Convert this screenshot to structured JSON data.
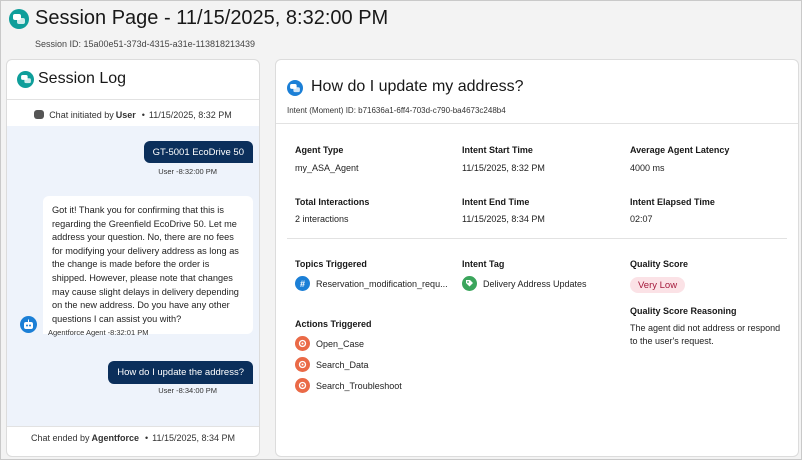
{
  "header": {
    "icon": "chat-bubbles-icon",
    "title": "Session Page - 11/15/2025, 8:32:00 PM",
    "session_id": "Session ID: 15a00e51-373d-4315-a31e-113818213439"
  },
  "session_log": {
    "title": "Session Log",
    "initiated": {
      "prefix": "Chat initiated by",
      "who": "User",
      "time": "11/15/2025, 8:32 PM"
    },
    "messages": [
      {
        "from": "user",
        "text": "GT-5001 EcoDrive 50",
        "meta": "User -8:32:00 PM"
      },
      {
        "from": "agent",
        "text": "Got it! Thank you for confirming that this is regarding the Greenfield EcoDrive 50. Let me address your question. No, there are no fees for modifying your delivery address as long as the change is made before the order is shipped. However, please note that changes may cause slight delays in delivery depending on the new address. Do you have any other questions I can assist you with?",
        "meta": "Agentforce Agent -8:32:01 PM"
      },
      {
        "from": "user",
        "text": "How do I update the address?",
        "meta": "User -8:34:00 PM"
      }
    ],
    "ended": {
      "prefix": "Chat ended by",
      "who": "Agentforce",
      "time": "11/15/2025, 8:34 PM"
    }
  },
  "intent": {
    "title": "How do I update my address?",
    "id_line": "Intent (Moment) ID: b71636a1-6ff4-703d-c790-ba4673c248b4",
    "fields": {
      "agent_type": {
        "label": "Agent Type",
        "value": "my_ASA_Agent"
      },
      "start_time": {
        "label": "Intent Start Time",
        "value": "11/15/2025, 8:32 PM"
      },
      "latency": {
        "label": "Average Agent Latency",
        "value": "4000 ms"
      },
      "interactions": {
        "label": "Total Interactions",
        "value": "2 interactions"
      },
      "end_time": {
        "label": "Intent End Time",
        "value": "11/15/2025, 8:34 PM"
      },
      "elapsed": {
        "label": "Intent Elapsed Time",
        "value": "02:07"
      }
    },
    "topics": {
      "label": "Topics Triggered",
      "items": [
        "Reservation_modification_requ..."
      ]
    },
    "tag": {
      "label": "Intent Tag",
      "value": "Delivery Address Updates"
    },
    "quality": {
      "label": "Quality Score",
      "value": "Very Low"
    },
    "actions": {
      "label": "Actions Triggered",
      "items": [
        "Open_Case",
        "Search_Data",
        "Search_Troubleshoot"
      ]
    },
    "reasoning": {
      "label": "Quality Score Reasoning",
      "text": "The agent did not address or respond to the user's request."
    }
  },
  "colors": {
    "teal": "#0e9e9a",
    "blue": "#1b7fd6",
    "navy": "#0b2f5b",
    "orange": "#ea6a47",
    "green": "#3ba55c",
    "badge_bg": "#fbe2e6",
    "badge_fg": "#a4193b"
  }
}
